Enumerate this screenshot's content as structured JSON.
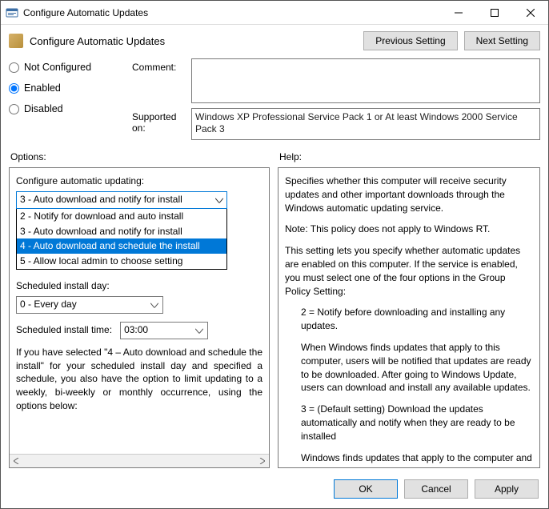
{
  "window": {
    "title": "Configure Automatic Updates"
  },
  "header": {
    "title": "Configure Automatic Updates",
    "prev": "Previous Setting",
    "next": "Next Setting"
  },
  "state": {
    "not_configured": "Not Configured",
    "enabled": "Enabled",
    "disabled": "Disabled",
    "selected": "enabled"
  },
  "comment": {
    "label": "Comment:",
    "value": ""
  },
  "supported": {
    "label": "Supported on:",
    "value": "Windows XP Professional Service Pack 1 or At least Windows 2000 Service Pack 3"
  },
  "section_labels": {
    "options": "Options:",
    "help": "Help:"
  },
  "options_pane": {
    "configure_label": "Configure automatic updating:",
    "configure_value": "3 - Auto download and notify for install",
    "configure_choices": [
      "2 - Notify for download and auto install",
      "3 - Auto download and notify for install",
      "4 - Auto download and schedule the install",
      "5 - Allow local admin to choose setting"
    ],
    "configure_highlight_index": 2,
    "sched_day_label": "Scheduled install day:",
    "sched_day_value": "0 - Every day",
    "sched_time_label": "Scheduled install time:",
    "sched_time_value": "03:00",
    "footnote": "If you have selected \"4 – Auto download and schedule the install\" for your scheduled install day and specified a schedule, you also have the option to limit updating to a weekly, bi-weekly or monthly occurrence, using the options below:"
  },
  "help_pane": {
    "p1": "Specifies whether this computer will receive security updates and other important downloads through the Windows automatic updating service.",
    "p2": "Note: This policy does not apply to Windows RT.",
    "p3": "This setting lets you specify whether automatic updates are enabled on this computer. If the service is enabled, you must select one of the four options in the Group Policy Setting:",
    "p4": "2 = Notify before downloading and installing any updates.",
    "p5": "When Windows finds updates that apply to this computer, users will be notified that updates are ready to be downloaded. After going to Windows Update, users can download and install any available updates.",
    "p6": "3 = (Default setting) Download the updates automatically and notify when they are ready to be installed",
    "p7": "Windows finds updates that apply to the computer and"
  },
  "footer": {
    "ok": "OK",
    "cancel": "Cancel",
    "apply": "Apply"
  }
}
